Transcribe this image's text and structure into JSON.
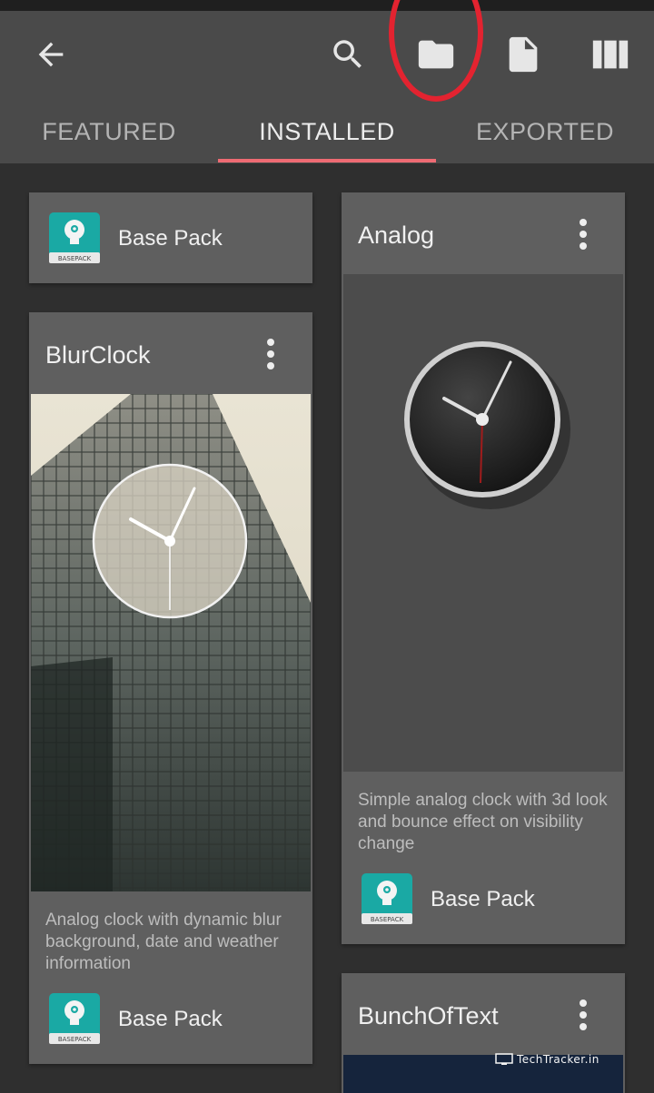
{
  "toolbar": {
    "back_icon": "arrow-left-icon",
    "search_icon": "search-icon",
    "folder_icon": "folder-icon",
    "file_icon": "file-icon",
    "layout_icon": "view-column-icon"
  },
  "tabs": [
    {
      "label": "FEATURED",
      "active": false
    },
    {
      "label": "INSTALLED",
      "active": true
    },
    {
      "label": "EXPORTED",
      "active": false
    }
  ],
  "colors": {
    "accent": "#ee6b73",
    "highlight": "#e32330",
    "appbar": "#4a4a4a",
    "card": "#5f5f5f",
    "background": "#2f2f2f"
  },
  "cards": {
    "base_pack_card": {
      "pack": "Base Pack"
    },
    "blurclock": {
      "title": "BlurClock",
      "description": "Analog clock with dynamic blur background, date and weather information",
      "pack": "Base Pack"
    },
    "analog": {
      "title": "Analog",
      "description": "Simple analog clock with 3d look and bounce effect on visibility change",
      "pack": "Base Pack"
    },
    "bunchoftext": {
      "title": "BunchOfText"
    }
  },
  "pack_icon_text": "BASEPACK",
  "watermark": "TechTracker.in"
}
